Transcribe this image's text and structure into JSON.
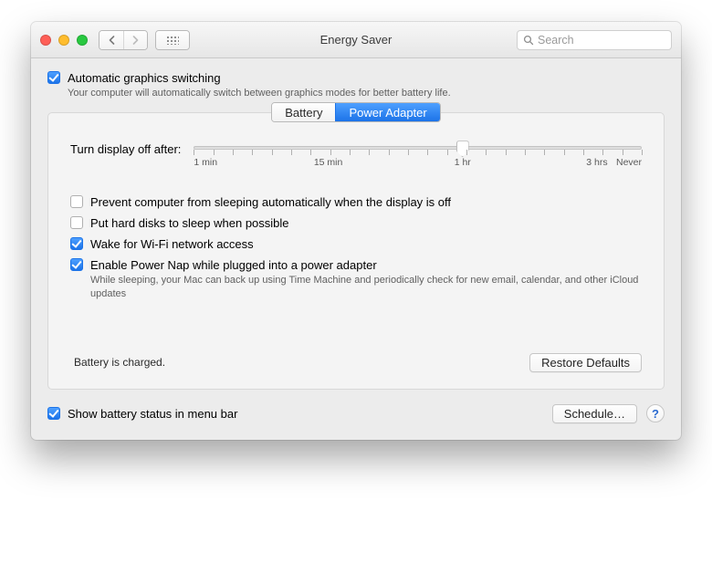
{
  "window": {
    "title": "Energy Saver",
    "search_placeholder": "Search"
  },
  "auto_graphics": {
    "checked": true,
    "label": "Automatic graphics switching",
    "subtext": "Your computer will automatically switch between graphics modes for better battery life."
  },
  "tabs": {
    "battery": "Battery",
    "power_adapter": "Power Adapter",
    "active": "power_adapter"
  },
  "slider": {
    "label": "Turn display off after:",
    "position_percent": 60,
    "ticks": [
      {
        "label": "1 min",
        "percent": 0
      },
      {
        "label": "15 min",
        "percent": 30
      },
      {
        "label": "1 hr",
        "percent": 60
      },
      {
        "label": "3 hrs",
        "percent": 90
      },
      {
        "label": "Never",
        "percent": 100
      }
    ]
  },
  "options": {
    "prevent_sleep": {
      "checked": false,
      "label": "Prevent computer from sleeping automatically when the display is off"
    },
    "hard_disks_sleep": {
      "checked": false,
      "label": "Put hard disks to sleep when possible"
    },
    "wake_wifi": {
      "checked": true,
      "label": "Wake for Wi-Fi network access"
    },
    "power_nap": {
      "checked": true,
      "label": "Enable Power Nap while plugged into a power adapter",
      "subtext": "While sleeping, your Mac can back up using Time Machine and periodically check for new email, calendar, and other iCloud updates"
    }
  },
  "status": "Battery is charged.",
  "buttons": {
    "restore_defaults": "Restore Defaults",
    "schedule": "Schedule…"
  },
  "show_battery_menu": {
    "checked": true,
    "label": "Show battery status in menu bar"
  },
  "help_symbol": "?"
}
